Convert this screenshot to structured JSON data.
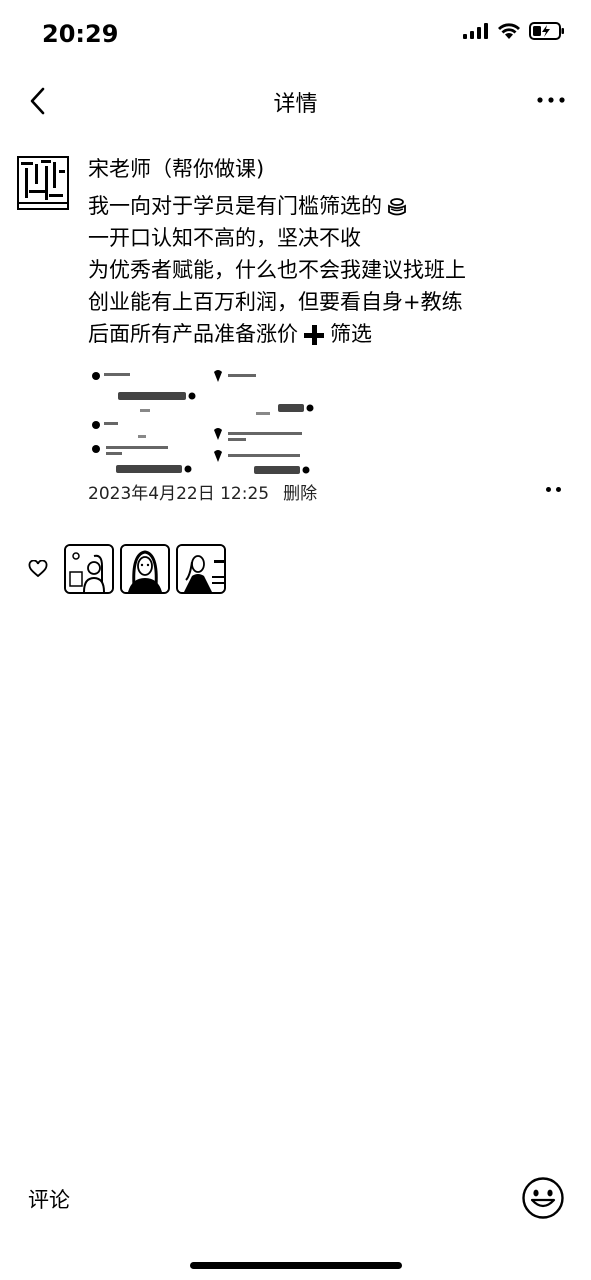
{
  "status": {
    "time": "20:29"
  },
  "nav": {
    "title": "详情"
  },
  "post": {
    "author": "宋老师（帮你做课)",
    "lines": [
      "我一向对于学员是有门槛筛选的",
      "一开口认知不高的，坚决不收",
      "为优秀者赋能，什么也不会我建议找班上",
      "创业能有上百万利润，但要看自身+教练",
      "后面所有产品准备涨价",
      "筛选"
    ],
    "date": "2023年4月22日 12:25",
    "delete_label": "删除"
  },
  "likes": {
    "count": 3
  },
  "comment": {
    "label": "评论"
  },
  "icons": [
    "back-icon",
    "more-icon",
    "heart-icon",
    "emoji-icon",
    "signal-icon",
    "wifi-icon",
    "battery-icon",
    "cake-icon",
    "plus-icon"
  ]
}
